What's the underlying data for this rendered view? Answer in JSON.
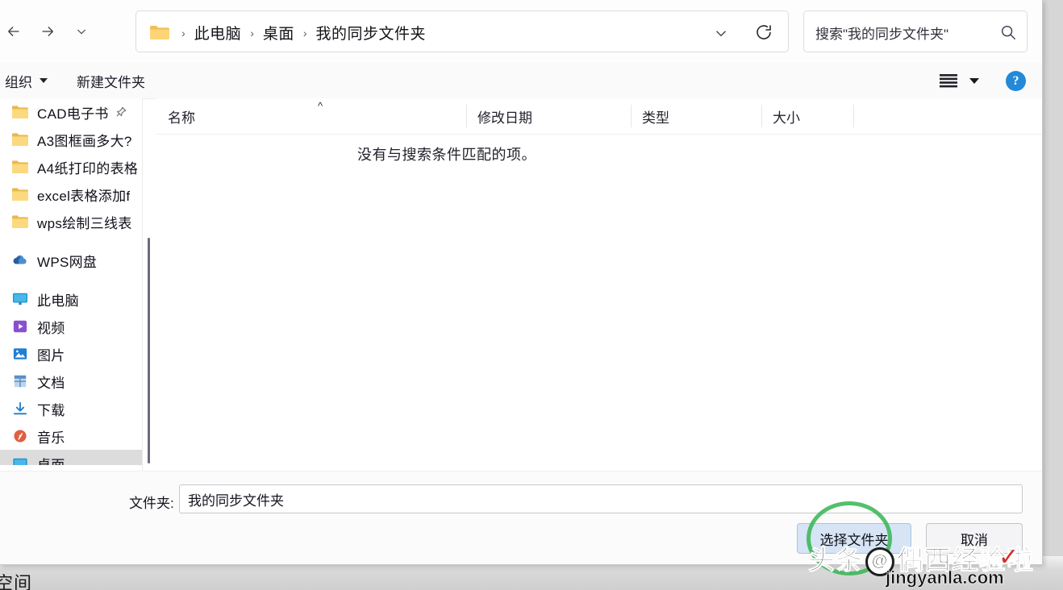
{
  "dialog": {
    "nav": {
      "back_icon": "arrow-left-icon",
      "forward_icon": "arrow-right-icon",
      "recent_icon": "chevron-down-icon",
      "up_icon": "arrow-up-icon"
    },
    "address": {
      "folder_icon": "folder-icon",
      "breadcrumbs": [
        "此电脑",
        "桌面",
        "我的同步文件夹"
      ],
      "separator": "›",
      "dropdown_icon": "chevron-down-icon",
      "refresh_icon": "refresh-icon"
    },
    "search": {
      "placeholder": "搜索\"我的同步文件夹\"",
      "icon": "search-icon"
    },
    "toolbar": {
      "organize_label": "组织",
      "new_folder_label": "新建文件夹",
      "view_icon": "list-view-icon",
      "view_caret_icon": "chevron-down-icon",
      "help_icon": "help-icon",
      "help_glyph": "?"
    },
    "sidebar": {
      "quick_access": [
        {
          "label": "CAD电子书",
          "icon": "folder-icon",
          "pinned": true,
          "pin_icon": "pin-icon"
        },
        {
          "label": "A3图框画多大?",
          "icon": "folder-icon",
          "pinned": false
        },
        {
          "label": "A4纸打印的表格",
          "icon": "folder-icon",
          "pinned": false
        },
        {
          "label": "excel表格添加f",
          "icon": "folder-icon",
          "pinned": false
        },
        {
          "label": "wps绘制三线表",
          "icon": "folder-icon",
          "pinned": false
        }
      ],
      "cloud": [
        {
          "label": "WPS网盘",
          "icon": "cloud-icon"
        }
      ],
      "this_pc": [
        {
          "label": "此电脑",
          "icon": "computer-icon"
        },
        {
          "label": "视频",
          "icon": "video-icon"
        },
        {
          "label": "图片",
          "icon": "pictures-icon"
        },
        {
          "label": "文档",
          "icon": "documents-icon"
        },
        {
          "label": "下载",
          "icon": "downloads-icon"
        },
        {
          "label": "音乐",
          "icon": "music-icon"
        },
        {
          "label": "桌面",
          "icon": "desktop-icon",
          "selected": true
        }
      ]
    },
    "list": {
      "columns": [
        {
          "label": "名称",
          "sorted": true,
          "sort_caret": "^"
        },
        {
          "label": "修改日期"
        },
        {
          "label": "类型"
        },
        {
          "label": "大小"
        }
      ],
      "empty_message": "没有与搜索条件匹配的项。"
    },
    "footer": {
      "folder_label": "文件夹:",
      "folder_value": "我的同步文件夹",
      "select_button": "选择文件夹",
      "cancel_button": "取消"
    }
  },
  "annotation": {
    "circle_color": "#35b552",
    "target": "选择文件夹"
  },
  "watermark": {
    "brand": "头条",
    "at": "@",
    "author": "偶西经验啦",
    "check": "✓",
    "site": "jingyanla.com"
  },
  "background": {
    "partial_text": "空间"
  }
}
